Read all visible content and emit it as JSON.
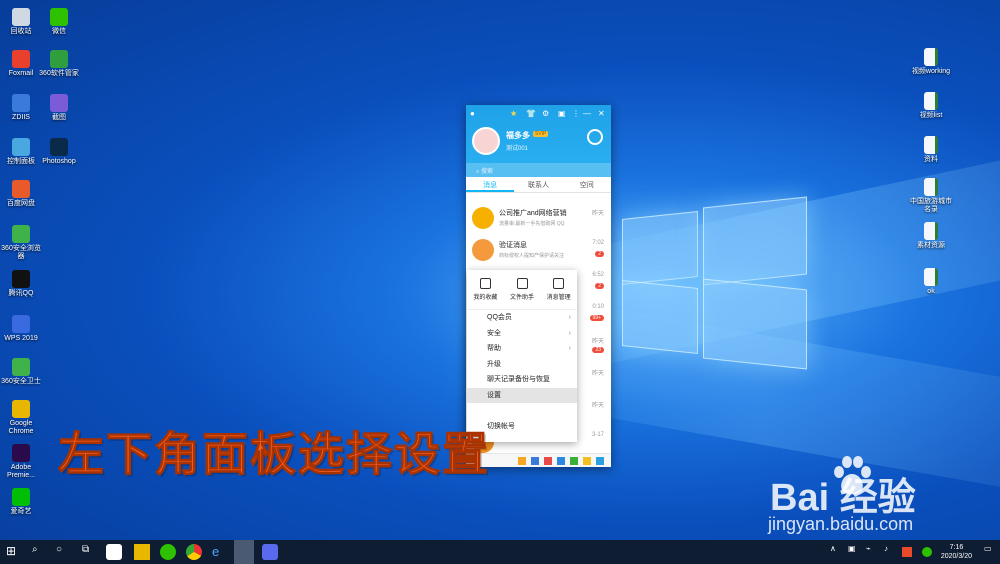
{
  "desktop": {
    "left_icons": [
      {
        "label": "回收站",
        "icon": "recycle-bin-icon",
        "color": "#cfd8e3"
      },
      {
        "label": "微信",
        "icon": "wechat-icon",
        "color": "#2dc100"
      },
      {
        "label": "Foxmail",
        "icon": "foxmail-icon",
        "color": "#e8402c"
      },
      {
        "label": "360软件管家",
        "icon": "360-software-icon",
        "color": "#2e9e3e"
      },
      {
        "label": "ZDIIS",
        "icon": "app-icon",
        "color": "#3a7ad8"
      },
      {
        "label": "截图",
        "icon": "screenshot-icon",
        "color": "#7a5cd8"
      },
      {
        "label": "控制面板",
        "icon": "control-panel-icon",
        "color": "#4aa8e0"
      },
      {
        "label": "Photoshop",
        "icon": "photoshop-icon",
        "color": "#0a2a4a"
      },
      {
        "label": "百度网盘",
        "icon": "baidu-netdisk-icon",
        "color": "#e85a2a"
      },
      {
        "label": "360安全浏览器",
        "icon": "360-browser-icon",
        "color": "#3fb24a"
      },
      {
        "label": "腾讯QQ",
        "icon": "qq-icon",
        "color": "#111111"
      },
      {
        "label": "WPS 2019",
        "icon": "wps-icon",
        "color": "#3a6ae0"
      },
      {
        "label": "360安全卫士",
        "icon": "360-guard-icon",
        "color": "#3fb24a"
      },
      {
        "label": "Google Chrome",
        "icon": "chrome-icon",
        "color": "#e6b600"
      },
      {
        "label": "Adobe Premie...",
        "icon": "premiere-icon",
        "color": "#2a0a4a"
      },
      {
        "label": "爱奇艺",
        "icon": "iqiyi-icon",
        "color": "#00be06"
      }
    ],
    "right_icons": [
      {
        "label": "视频working",
        "icon": "file-icon"
      },
      {
        "label": "视频list",
        "icon": "file-icon"
      },
      {
        "label": "资料",
        "icon": "file-icon"
      },
      {
        "label": "中国旅游城市名录",
        "icon": "file-icon"
      },
      {
        "label": "素材资源",
        "icon": "file-icon"
      },
      {
        "label": "ok",
        "icon": "file-icon"
      }
    ]
  },
  "qq": {
    "nickname": "福多多",
    "vip": "SVIP",
    "signature": "测试001",
    "search_placeholder": "搜索",
    "tabs": [
      "消息",
      "联系人",
      "空间"
    ],
    "chats": [
      {
        "title": "公司推广and网络营销",
        "preview": "流量串:最新一手先借助网 QQ",
        "time": "昨天",
        "badge": "",
        "avatar_color": "#f5b000"
      },
      {
        "title": "验证消息",
        "preview": "商标侵权人提知产保护请关注",
        "time": "7:02",
        "badge": "2",
        "avatar_color": "#f59a3c"
      },
      {
        "title": "",
        "preview": "",
        "time": "6:52",
        "badge": "2",
        "avatar_color": "#8fc3e8"
      },
      {
        "title": "",
        "preview": "",
        "time": "0:10",
        "badge": "99+",
        "avatar_color": "#aaaaaa"
      },
      {
        "title": "",
        "preview": "",
        "time": "昨天",
        "badge": "23",
        "avatar_color": "#f07050"
      },
      {
        "title": "",
        "preview": "",
        "time": "昨天",
        "badge": "",
        "avatar_color": "#9ac"
      },
      {
        "title": "",
        "preview": "",
        "time": "昨天",
        "badge": "",
        "avatar_color": "#c9a"
      },
      {
        "title": "",
        "preview": "",
        "time": "3-17",
        "badge": "",
        "avatar_color": "#f09020"
      }
    ]
  },
  "menu": {
    "top_items": [
      "我的收藏",
      "文件助手",
      "消息管理"
    ],
    "items": [
      {
        "label": "QQ会员",
        "submenu": true
      },
      {
        "label": "安全",
        "submenu": true
      },
      {
        "label": "帮助",
        "submenu": true
      },
      {
        "label": "升级",
        "submenu": false
      },
      {
        "label": "聊天记录备份与恢复",
        "submenu": false
      },
      {
        "label": "设置",
        "submenu": false,
        "selected": true
      },
      {
        "label": "",
        "submenu": false
      },
      {
        "label": "切换帐号",
        "submenu": false
      }
    ],
    "submenu_glyph": "›"
  },
  "caption": "左下角面板选择设置",
  "watermark": {
    "brand": "Bai  经验",
    "url": "jingyan.baidu.com"
  },
  "clock": {
    "time": "7:16",
    "date": "2020/3/20"
  }
}
